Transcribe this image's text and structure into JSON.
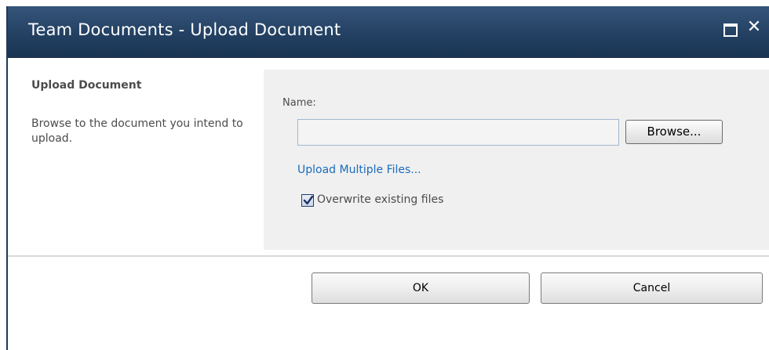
{
  "dialog": {
    "title": "Team Documents - Upload Document",
    "close_glyph": "✕"
  },
  "section": {
    "title": "Upload Document",
    "description": "Browse to the document you intend to upload."
  },
  "form": {
    "name_label": "Name:",
    "name_value": "",
    "browse_label": "Browse...",
    "upload_multiple_link": "Upload Multiple Files...",
    "overwrite_label": "Overwrite existing files",
    "overwrite_checked": true
  },
  "footer": {
    "ok_label": "OK",
    "cancel_label": "Cancel"
  },
  "colors": {
    "titlebar": "#223f60",
    "link": "#1b6cbc",
    "right_pane_bg": "#f0f0f0"
  },
  "icons": {
    "maximize": "maximize-icon",
    "close": "close-icon",
    "check": "checkmark-icon"
  }
}
